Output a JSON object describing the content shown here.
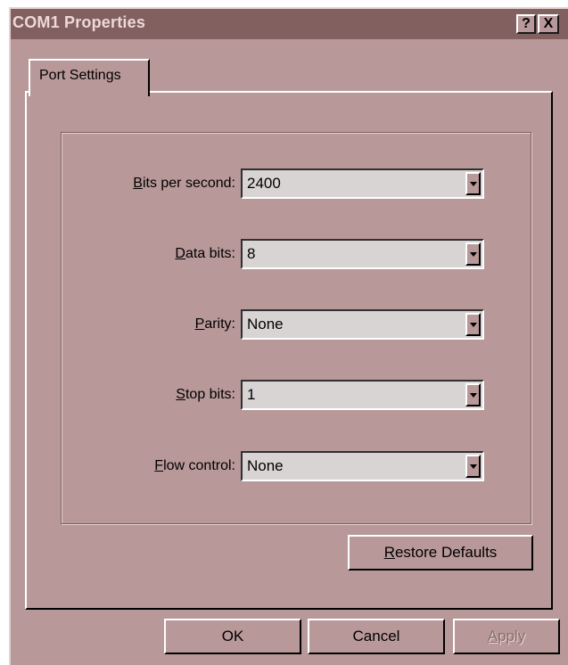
{
  "window": {
    "title": "COM1 Properties"
  },
  "titlebar_buttons": {
    "help": "?",
    "close": "X"
  },
  "tabs": [
    {
      "label": "Port Settings",
      "active": true
    }
  ],
  "fields": [
    {
      "accel": "B",
      "rest": "its per second:",
      "value": "2400"
    },
    {
      "accel": "D",
      "rest": "ata bits:",
      "value": "8"
    },
    {
      "accel": "P",
      "rest": "arity:",
      "value": "None"
    },
    {
      "accel": "S",
      "rest": "top bits:",
      "value": "1"
    },
    {
      "accel": "F",
      "rest": "low control:",
      "value": "None"
    }
  ],
  "buttons": {
    "restore_accel": "R",
    "restore_rest": "estore Defaults",
    "ok": "OK",
    "cancel": "Cancel",
    "apply_accel": "A",
    "apply_rest": "pply"
  },
  "colors": {
    "face": "#b89898",
    "title_bar": "#826060",
    "field_bg": "#d8d4d4"
  }
}
